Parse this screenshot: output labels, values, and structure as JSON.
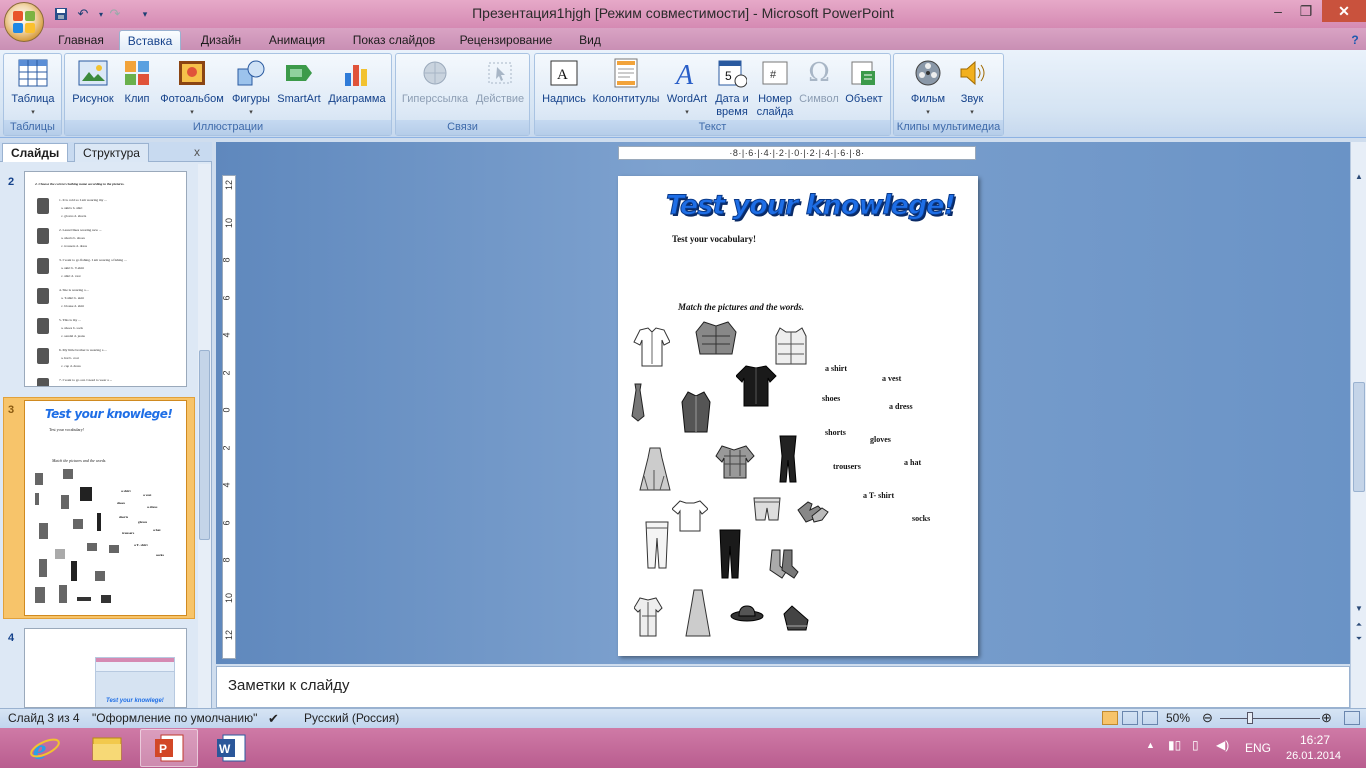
{
  "window": {
    "title": "Презентация1hjgh [Режим совместимости] - Microsoft PowerPoint",
    "minimize": "–",
    "restore": "❐",
    "close": "✕"
  },
  "qat": [
    "save-icon",
    "undo-icon",
    "redo-icon",
    "customize-icon"
  ],
  "ribbon_tabs": [
    "Главная",
    "Вставка",
    "Дизайн",
    "Анимация",
    "Показ слайдов",
    "Рецензирование",
    "Вид"
  ],
  "active_tab": "Вставка",
  "groups": {
    "tables": {
      "label": "Таблицы",
      "buttons": [
        "Таблица"
      ]
    },
    "illustrations": {
      "label": "Иллюстрации",
      "buttons": [
        "Рисунок",
        "Клип",
        "Фотоальбом",
        "Фигуры",
        "SmartArt",
        "Диаграмма"
      ]
    },
    "links": {
      "label": "Связи",
      "buttons": [
        "Гиперссылка",
        "Действие"
      ]
    },
    "text": {
      "label": "Текст",
      "buttons": [
        "Надпись",
        "Колонтитулы",
        "WordArt",
        "Дата и",
        "время",
        "Номер",
        "слайда",
        "Символ",
        "Объект"
      ]
    },
    "media": {
      "label": "Клипы мультимедиа",
      "buttons": [
        "Фильм",
        "Звук"
      ]
    }
  },
  "pane": {
    "tabs": [
      "Слайды",
      "Структура"
    ],
    "close": "x",
    "thumbnails": [
      {
        "num": "2"
      },
      {
        "num": "3"
      },
      {
        "num": "4"
      }
    ]
  },
  "ruler": {
    "horizontal": "·8·|·6·|·4·|·2·|·0·|·2·|·4·|·6·|·8·",
    "vertical": [
      "12",
      "10",
      "8",
      "6",
      "4",
      "2",
      "0",
      "2",
      "4",
      "6",
      "8",
      "10",
      "12"
    ]
  },
  "slide": {
    "title": "Test your knowlege!",
    "subtitle": "Test your vocabulary!",
    "instruction": "Match the pictures and the words.",
    "words": [
      "a shirt",
      "a vest",
      "shoes",
      "a dress",
      "shorts",
      "gloves",
      "trousers",
      "a hat",
      "a T- shirt",
      "socks"
    ]
  },
  "thumb2": {
    "heading": "2. Choose the correct clothing name according to the pictures.",
    "lines": [
      "1. It is cold so I am wearing my ...",
      "a. skirts   b. shirt",
      "c. gloves   d. shorts",
      "2. Laurel likes wearing new ...",
      "a. shorts   b. shoes",
      "c. trousers   d. dress",
      "3. I want to go fishing. I am wearing a fishing ...",
      "a. skirt   b. T-shirt",
      "c. shirt   d. vest",
      "4. She is wearing a ...",
      "a. T-shirt   b. skirt",
      "c. blouse   d. shirt",
      "5. This is my ...",
      "a. shoes   b. sock",
      "c. sandal   d. jeans",
      "6. My little brother is wearing a ...",
      "a. hat   b. coat",
      "c. cap   d. dress",
      "7. I want to go out. I need to wear a ...",
      "a. cap   b. hat",
      "c. dress   d. coat"
    ]
  },
  "thumb4": {
    "title": "Test your knowlege!"
  },
  "notes": {
    "placeholder": "Заметки к слайду"
  },
  "status": {
    "slide": "Слайд 3 из 4",
    "theme": "\"Оформление по умолчанию\"",
    "language": "Русский (Россия)",
    "zoom": "50%",
    "zoom_value": 0.5
  },
  "taskbar": {
    "apps": [
      "internet-explorer-icon",
      "file-explorer-icon",
      "powerpoint-icon",
      "word-icon"
    ],
    "lang": "ENG",
    "time": "16:27",
    "date": "26.01.2014"
  },
  "colors": {
    "title_bar": "#d58ab3",
    "ribbon": "#d5e4f3",
    "editor_bg": "#6a93c6",
    "slide_title": "#1e6ee6",
    "taskbar": "#b95d8f"
  }
}
